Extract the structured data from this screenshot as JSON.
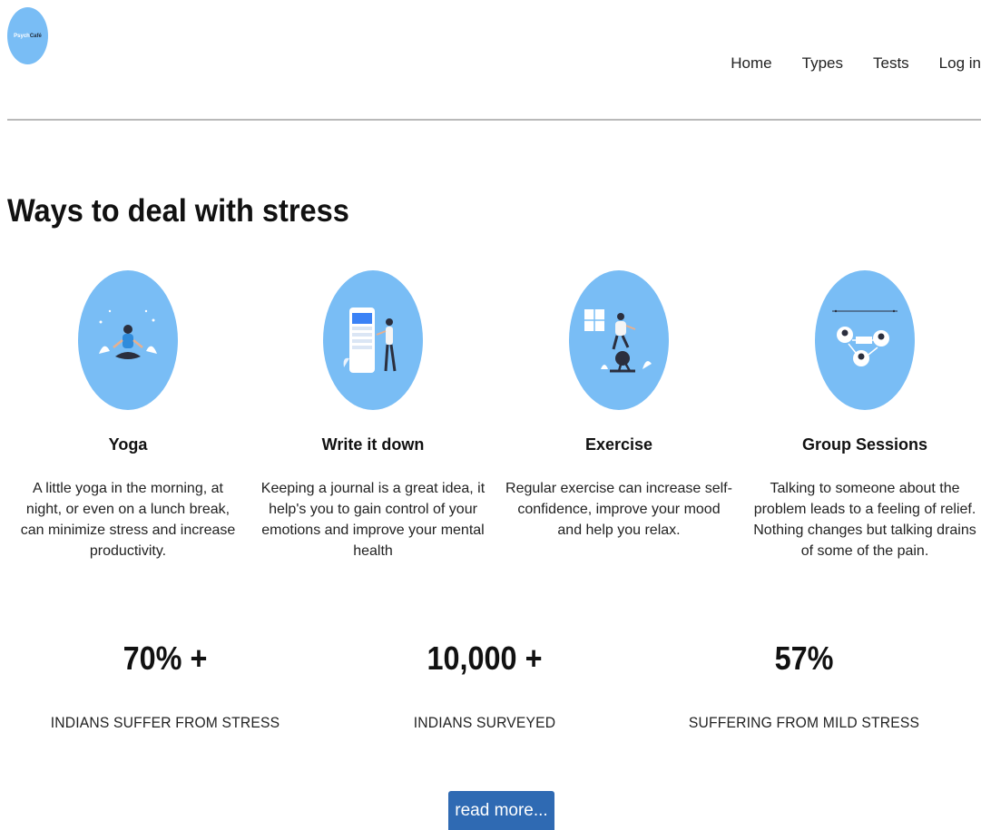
{
  "header": {
    "logo_text_a": "Psych",
    "logo_text_b": "Café",
    "nav": [
      "Home",
      "Types",
      "Tests",
      "Log in"
    ]
  },
  "main": {
    "title": "Ways to deal with stress",
    "cards": [
      {
        "title": "Yoga",
        "text": "A little yoga in the morning, at night, or even on a lunch break, can minimize stress and increase productivity.",
        "icon": "yoga-illustration-icon"
      },
      {
        "title": "Write it down",
        "text": "Keeping a journal is a great idea, it help's you to gain control of your emotions and improve your mental health",
        "icon": "journal-illustration-icon"
      },
      {
        "title": "Exercise",
        "text": "Regular exercise can increase self-confidence, improve your mood and help you relax.",
        "icon": "exercise-illustration-icon"
      },
      {
        "title": "Group Sessions",
        "text": "Talking to someone about the problem leads to a feeling of relief. Nothing changes but talking drains of some of the pain.",
        "icon": "group-session-illustration-icon"
      }
    ],
    "stats": [
      {
        "value": "70% +",
        "label": "INDIANS SUFFER FROM STRESS"
      },
      {
        "value": "10,000 +",
        "label": "INDIANS SURVEYED"
      },
      {
        "value": "57%",
        "label": "SUFFERING FROM MILD STRESS"
      }
    ],
    "button_label": "read more..."
  },
  "colors": {
    "accent_circle": "#79bdf5",
    "button": "#2f6ab3",
    "rule": "#b9b9b9"
  }
}
